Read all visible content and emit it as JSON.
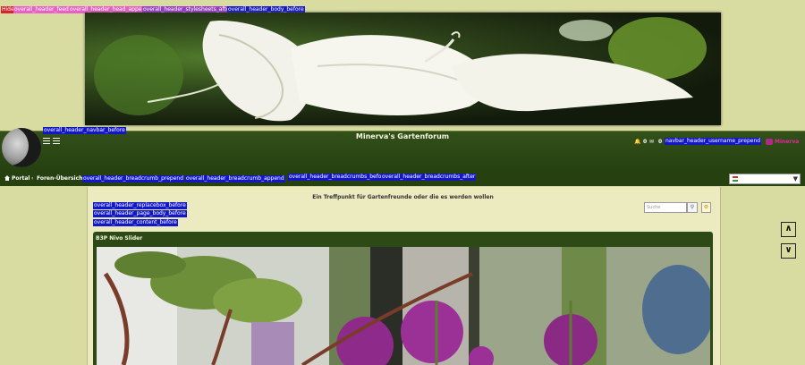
{
  "debug_tags": {
    "hide": "Hide",
    "overall_header_feeds": "overall_header_feeds",
    "overall_header_head_append": "overall_header_head_append",
    "overall_header_stylesheets_after": "overall_header_stylesheets_after",
    "overall_header_body_before": "overall_header_body_before",
    "overall_header_navbar_before": "overall_header_navbar_before",
    "navbar_header_username_prepend": "navbar_header_username_prepend",
    "overall_header_breadcrumb_prepend": "overall_header_breadcrumb_prepend",
    "overall_header_breadcrumb_append": "overall_header_breadcrumb_append",
    "overall_header_breadcrumbs_before": "overall_header_breadcrumbs_before",
    "overall_header_breadcrumbs_after": "overall_header_breadcrumbs_after",
    "overall_header_replacebox_before": "overall_header_replacebox_before",
    "overall_header_page_body_before": "overall_header_page_body_before",
    "overall_header_content_before": "overall_header_content_before"
  },
  "navbar": {
    "site_title": "Minerva's Gartenforum",
    "notification_count": "0",
    "message_count": "0",
    "username": "Minerva"
  },
  "breadcrumb": {
    "portal": "Portal",
    "forum_index": "Foren-Übersicht"
  },
  "tagline": "Ein Treffpunkt für Gartenfreunde oder die es werden wollen",
  "search": {
    "placeholder": "Suche"
  },
  "slider": {
    "title": "B3P Nivo Slider"
  },
  "icons": {
    "menu": "hamburger-icon",
    "bell": "bell-icon",
    "envelope": "envelope-icon",
    "home": "home-icon",
    "search": "search-icon",
    "advanced": "gear-icon",
    "up": "chevron-up-icon",
    "down": "chevron-down-icon"
  },
  "colors": {
    "navbar": "#2b4716",
    "page_bg": "#d9dca0",
    "content_bg": "#ecebc0",
    "username": "#e0299a"
  }
}
